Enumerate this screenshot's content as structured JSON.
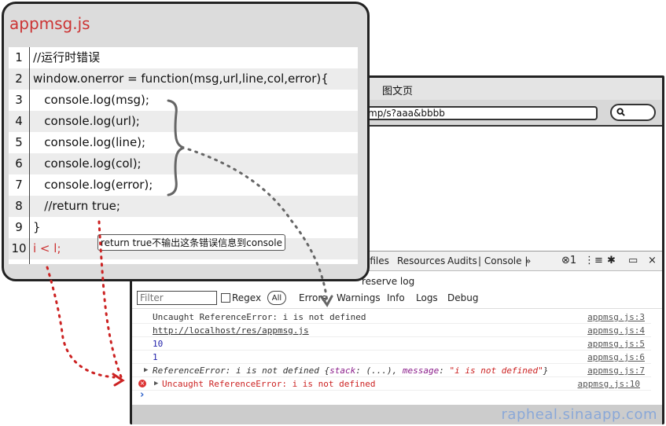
{
  "browser": {
    "title": "图文页",
    "address": "mp/s?aaa&bbbb"
  },
  "devtools": {
    "tabs": [
      "ofiles",
      "Resources",
      "Audits",
      "Console",
      "»"
    ],
    "active_tab": "Console",
    "errors_count": "1",
    "preserve_log": "reserve log",
    "filter_placeholder": "Filter",
    "regex_label": "Regex",
    "all_label": "All",
    "levels": [
      "Errors",
      "Warnings",
      "Info",
      "Logs",
      "Debug"
    ]
  },
  "console": {
    "rows": [
      {
        "message": "Uncaught ReferenceError: i is not defined",
        "source": "appmsg.js:3",
        "kind": "plain"
      },
      {
        "message": "http://localhost/res/appmsg.js",
        "source": "appmsg.js:4",
        "kind": "link"
      },
      {
        "message": "10",
        "source": "appmsg.js:5",
        "kind": "number"
      },
      {
        "message": "1",
        "source": "appmsg.js:6",
        "kind": "number"
      },
      {
        "message": "ReferenceError: i is not defined {stack: (...), message: \"i is not defined\"}",
        "source": "appmsg.js:7",
        "kind": "object"
      },
      {
        "message": "Uncaught ReferenceError: i is not defined",
        "source": "appmsg.js:10",
        "kind": "error"
      }
    ],
    "object_parts": {
      "prefix": "ReferenceError: i is not defined {",
      "key1": "stack",
      "val1": ": (...), ",
      "key2": "message",
      "colon2": ": ",
      "val2": "\"i is not defined\"",
      "suffix": "}"
    }
  },
  "footer": {
    "brand": "rapheal.sinaapp.com"
  },
  "code_panel": {
    "title": "appmsg.js",
    "lines": [
      {
        "num": "1",
        "code": "//运行时错误"
      },
      {
        "num": "2",
        "code": "window.onerror = function(msg,url,line,col,error){"
      },
      {
        "num": "3",
        "code": "   console.log(msg);"
      },
      {
        "num": "4",
        "code": "   console.log(url);"
      },
      {
        "num": "5",
        "code": "   console.log(line);"
      },
      {
        "num": "6",
        "code": "   console.log(col);"
      },
      {
        "num": "7",
        "code": "   console.log(error);"
      },
      {
        "num": "8",
        "code": "   //return true;"
      },
      {
        "num": "9",
        "code": "}"
      },
      {
        "num": "10",
        "code": "i < l;"
      }
    ],
    "tooltip": "return true不输出这条错误信息到console"
  },
  "colors": {
    "accent_red": "#cc3333",
    "link_blue": "#2222aa",
    "brand_blue": "#8aa8d8"
  }
}
